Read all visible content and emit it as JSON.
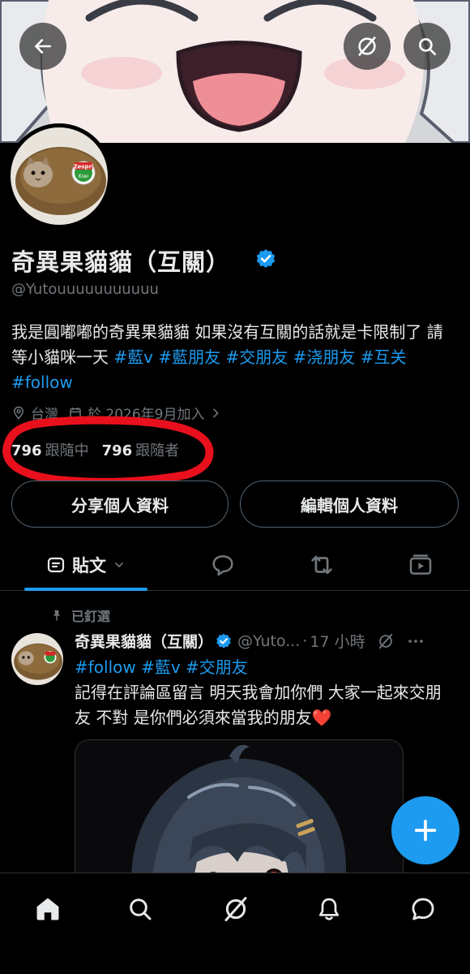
{
  "profile": {
    "display_name": "奇異果貓貓（互關）",
    "handle": "@Yutouuuuuuuuuuu",
    "bio_text": "我是圓嘟嘟的奇異果貓貓 如果沒有互關的話就是卡限制了 請等小貓咪一天 ",
    "bio_tags": [
      "#藍v",
      "#藍朋友",
      "#交朋友",
      "#浇朋友",
      "#互关",
      "#follow"
    ],
    "meta_location": "台灣",
    "meta_joined": "於 2026年9月加入",
    "following_count": "796",
    "following_label": "跟隨中",
    "followers_count": "796",
    "followers_label": "跟隨者",
    "share_button": "分享個人資料",
    "edit_button": "編輯個人資料",
    "avatar_sticker_text": "Zespri",
    "avatar_sticker_sub": "Kiwi"
  },
  "tabs": {
    "posts_label": "貼文"
  },
  "pinned_tweet": {
    "pinned_label": "已釘選",
    "author_name": "奇異果貓貓（互關）",
    "author_handle": "@Yuto...",
    "dot": "·",
    "time": "17 小時",
    "tags": "#follow #藍v #交朋友",
    "text": "記得在評論區留言 明天我會加你們 大家一起來交朋友 不對 是你們必須來當我的朋友",
    "heart": "❤️"
  },
  "icons": {
    "back": "arrow-left-icon",
    "grok": "grok-icon",
    "search": "search-icon",
    "verified": "verified-badge-icon",
    "replies": "speech-bubble-icon",
    "retweets": "retweet-icon",
    "media": "media-icon",
    "compose": "plus-icon",
    "home": "home-icon",
    "notifications": "bell-icon",
    "messages": "message-icon",
    "location": "location-icon",
    "calendar": "calendar-icon",
    "chevron": "chevron-right-icon",
    "pin": "pin-icon",
    "more": "more-icon"
  },
  "colors": {
    "accent": "#1d9bf0",
    "background": "#000000",
    "text_primary": "#e7e9ea",
    "text_secondary": "#71767b",
    "scribble": "#e8101c"
  }
}
